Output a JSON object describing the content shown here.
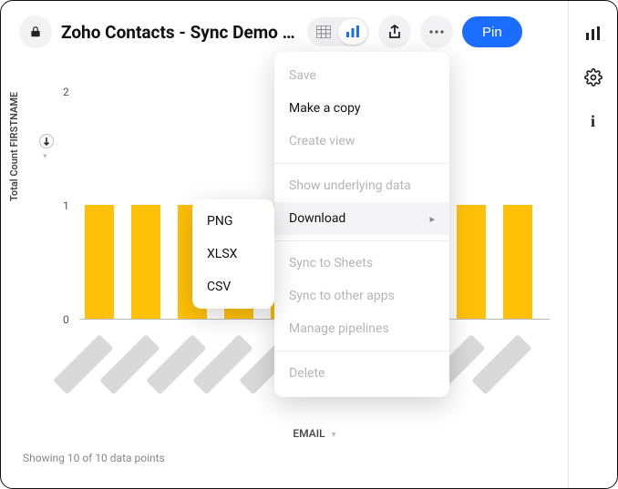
{
  "header": {
    "title": "Zoho Contacts - Sync Demo (…",
    "pin_label": "Pin"
  },
  "menu": {
    "save": "Save",
    "make_copy": "Make a copy",
    "create_view": "Create view",
    "show_underlying": "Show underlying data",
    "download": "Download",
    "sync_sheets": "Sync to Sheets",
    "sync_apps": "Sync to other apps",
    "manage_pipelines": "Manage pipelines",
    "delete": "Delete"
  },
  "download_formats": {
    "png": "PNG",
    "xlsx": "XLSX",
    "csv": "CSV"
  },
  "chart_axes": {
    "ylabel": "Total Count  FIRSTNAME",
    "xlabel": "EMAIL",
    "ytick0": "0",
    "ytick1": "1",
    "ytick2": "2"
  },
  "footer": {
    "showing": "Showing 10 of 10 data points"
  },
  "chart_data": {
    "type": "bar",
    "title": "",
    "xlabel": "EMAIL",
    "ylabel": "Total Count  FIRSTNAME",
    "ylim": [
      0,
      2
    ],
    "categories": [
      "(email 1)",
      "(email 2)",
      "(email 3)",
      "(email 4)",
      "(email 5)",
      "(email 6)",
      "(email 7)",
      "(email 8)",
      "(email 9)",
      "(email 10)"
    ],
    "values": [
      1,
      1,
      1,
      1,
      1,
      1,
      1,
      1,
      1,
      1
    ],
    "note": "Category labels are rotated and partially obscured in the source screenshot; exact email strings are not legible."
  }
}
